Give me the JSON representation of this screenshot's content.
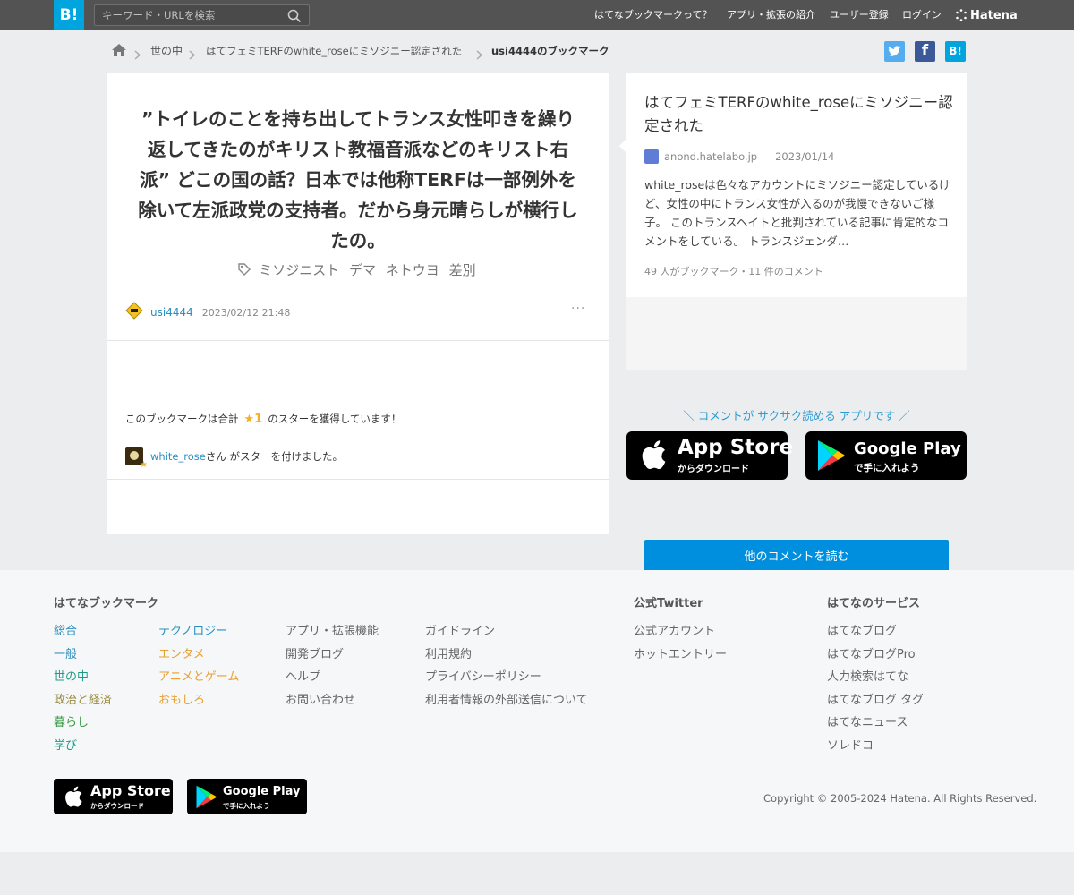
{
  "header": {
    "logo": "B!",
    "search_placeholder": "キーワード・URLを検索",
    "nav": [
      "はてなブックマークって？",
      "アプリ・拡張の紹介",
      "ユーザー登録",
      "ログイン"
    ],
    "brand": "Hatena"
  },
  "breadcrumb": {
    "items": [
      "世の中",
      "はてフェミTERFのwhite_roseにミソジニー認定された",
      "usi4444のブックマーク"
    ]
  },
  "social": {
    "twitter": "t",
    "facebook": "f",
    "hatena": "B!"
  },
  "bookmark": {
    "comment": "”トイレのことを持ち出してトランス女性叩きを繰り返してきたのがキリスト教福音派などのキリスト右派” どこの国の話？日本では他称TERFは一部例外を除いて左派政党の支持者。だから身元晴らしが横行したの。",
    "tags": [
      "ミソジニスト",
      "デマ",
      "ネトウヨ",
      "差別"
    ],
    "user": "usi4444",
    "date": "2023/02/12 21:48",
    "more": "···"
  },
  "stars": {
    "summary_prefix": "このブックマークは合計",
    "star_count": "★1",
    "summary_suffix": "のスターを獲得しています！",
    "giver": "white_rose",
    "giver_suffix": "さん がスターを付けました。"
  },
  "entry": {
    "title": "はてフェミTERFのwhite_roseにミソジニー認定された",
    "domain": "anond.hatelabo.jp",
    "date": "2023/01/14",
    "description": "white_roseは色々なアカウントにミソジニー認定しているけど、女性の中にトランス女性が入るのが我慢できないご様子。 このトランスヘイトと批判されている記事に肯定的なコメントをしている。 トランスジェンダ…",
    "counts": "49 人がブックマーク・11 件のコメント",
    "read_button": "他のコメントを読む"
  },
  "promo": {
    "text": "＼ コメントが サクサク読める アプリです ／",
    "appstore_big": "App Store",
    "appstore_small": "からダウンロード",
    "googleplay_big": "Google Play",
    "googleplay_small": "で手に入れよう"
  },
  "footer": {
    "col1_title": "はてなブックマーク",
    "categories_left": [
      "総合",
      "一般",
      "世の中",
      "政治と経済",
      "暮らし",
      "学び"
    ],
    "categories_right": [
      "テクノロジー",
      "エンタメ",
      "アニメとゲーム",
      "おもしろ"
    ],
    "links_a": [
      "アプリ・拡張機能",
      "開発ブログ",
      "ヘルプ",
      "お問い合わせ"
    ],
    "links_b": [
      "ガイドライン",
      "利用規約",
      "プライバシーポリシー",
      "利用者情報の外部送信について"
    ],
    "twitter_title": "公式Twitter",
    "twitter_links": [
      "公式アカウント",
      "ホットエントリー"
    ],
    "services_title": "はてなのサービス",
    "services": [
      "はてなブログ",
      "はてなブログPro",
      "人力検索はてな",
      "はてなブログ タグ",
      "はてなニュース",
      "ソレドコ"
    ],
    "copyright": "Copyright © 2005-2024 Hatena. All Rights Reserved."
  },
  "colors": {
    "header_bg": "#535353",
    "accent": "#00a4de",
    "button": "#008fde",
    "star": "#f4b128",
    "link": "#2a8fbf"
  }
}
